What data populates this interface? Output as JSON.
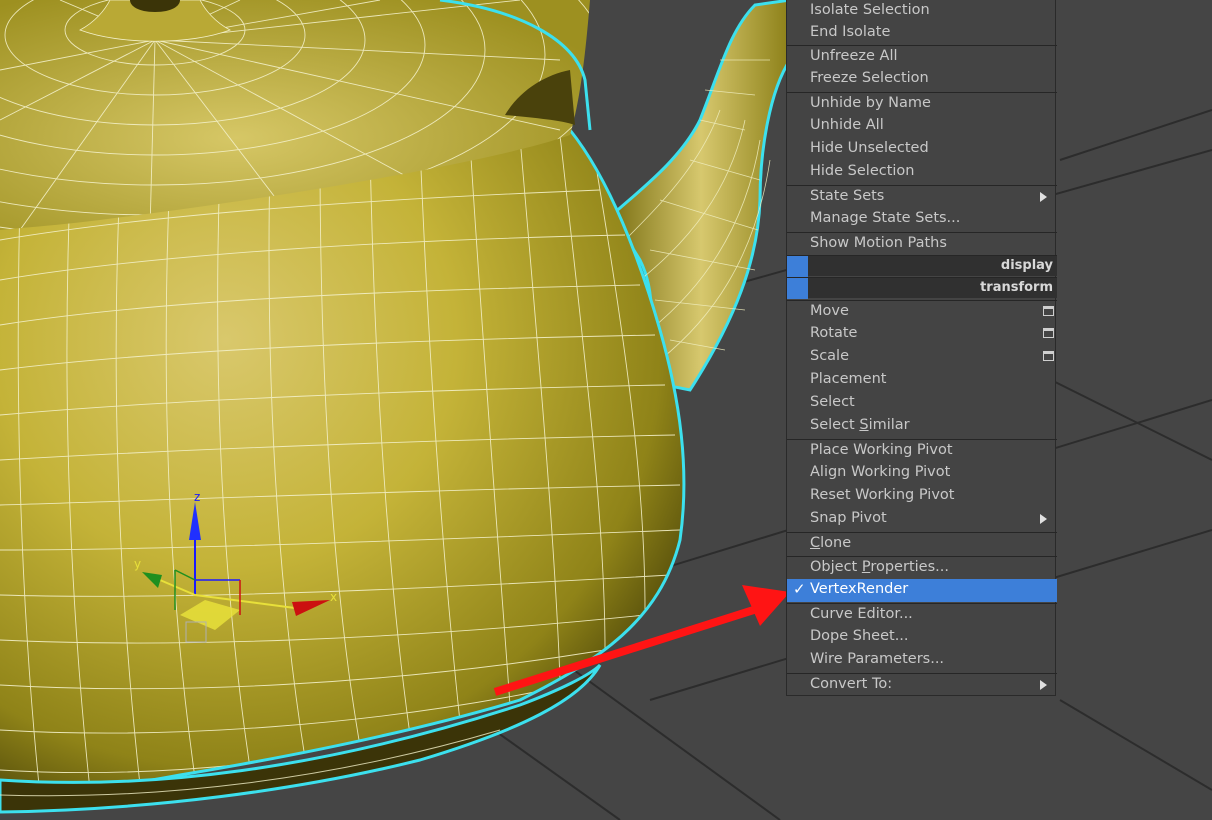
{
  "viewport": {
    "background": "#454545",
    "teapot_color": "#cdbb3a",
    "selection_outline": "#3ce0ee",
    "arrow_color": "#ff1414"
  },
  "gizmo": {
    "x_label": "x",
    "y_label": "y",
    "z_label": "z"
  },
  "menu": {
    "isolate_selection": "Isolate Selection",
    "end_isolate": "End Isolate",
    "unfreeze_all": "Unfreeze All",
    "freeze_selection": "Freeze Selection",
    "unhide_by_name": "Unhide by Name",
    "unhide_all": "Unhide All",
    "hide_unselected": "Hide Unselected",
    "hide_selection": "Hide Selection",
    "state_sets": "State Sets",
    "manage_state_sets": "Manage State Sets...",
    "show_motion_paths": "Show Motion Paths",
    "header_display": "display",
    "header_transform": "transform",
    "move": "Move",
    "rotate": "Rotate",
    "scale": "Scale",
    "placement": "Placement",
    "select": "Select",
    "select_similar_a": "Select ",
    "select_similar_b": "S",
    "select_similar_c": "imilar",
    "place_working_pivot": "Place Working Pivot",
    "align_working_pivot": "Align Working Pivot",
    "reset_working_pivot": "Reset Working Pivot",
    "snap_pivot": "Snap Pivot",
    "clone_a": "C",
    "clone_b": "lone",
    "object_properties_a": "Object ",
    "object_properties_b": "P",
    "object_properties_c": "roperties...",
    "check": "✓",
    "vertex_render": "VertexRender",
    "curve_editor": "Curve Editor...",
    "dope_sheet": "Dope Sheet...",
    "wire_parameters": "Wire Parameters...",
    "convert_to": "Convert To:",
    "highlight_color": "#3d7fd9"
  }
}
